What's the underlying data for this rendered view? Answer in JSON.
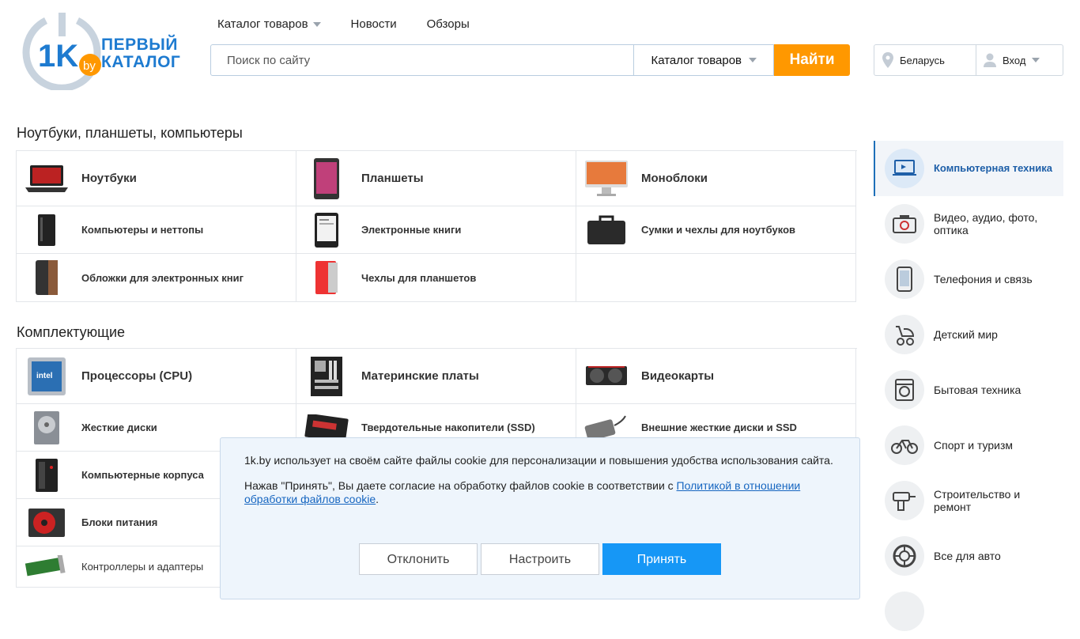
{
  "logo": {
    "mark": "1K",
    "by": "by",
    "line1": "ПЕРВЫЙ",
    "line2": "КАТАЛОГ"
  },
  "topnav": {
    "catalog": "Каталог товаров",
    "news": "Новости",
    "reviews": "Обзоры"
  },
  "search": {
    "placeholder": "Поиск по сайту",
    "category": "Каталог товаров",
    "button": "Найти"
  },
  "user": {
    "region": "Беларусь",
    "login": "Вход"
  },
  "sections": [
    {
      "title": "Ноутбуки, планшеты, компьютеры",
      "items": [
        "Ноутбуки",
        "Планшеты",
        "Моноблоки",
        "Компьютеры и неттопы",
        "Электронные книги",
        "Сумки и чехлы для ноутбуков",
        "Обложки для электронных книг",
        "Чехлы для планшетов"
      ]
    },
    {
      "title": "Комплектующие",
      "items": [
        "Процессоры (CPU)",
        "Материнские платы",
        "Видеокарты",
        "Жесткие диски",
        "Твердотельные накопители (SSD)",
        "Внешние жесткие диски и SSD",
        "Компьютерные корпуса",
        "Блоки питания",
        "Контроллеры и адаптеры"
      ]
    }
  ],
  "sidebar": [
    "Компьютерная техника",
    "Видео, аудио, фото, оптика",
    "Телефония и связь",
    "Детский мир",
    "Бытовая техника",
    "Спорт и туризм",
    "Строительство и ремонт",
    "Все для авто"
  ],
  "cookie": {
    "text1": "1k.by использует на своём сайте файлы cookie для персонализации и повышения удобства использования сайта.",
    "text2": "Нажав \"Принять\", Вы даете согласие на обработку файлов cookie в соответствии с ",
    "link": "Политикой в отношении обработки файлов cookie",
    "text2_end": ".",
    "decline": "Отклонить",
    "configure": "Настроить",
    "accept": "Принять"
  },
  "colors": {
    "brand_blue": "#1e7bd0",
    "orange": "#ff9800",
    "accept_blue": "#1697f6"
  }
}
